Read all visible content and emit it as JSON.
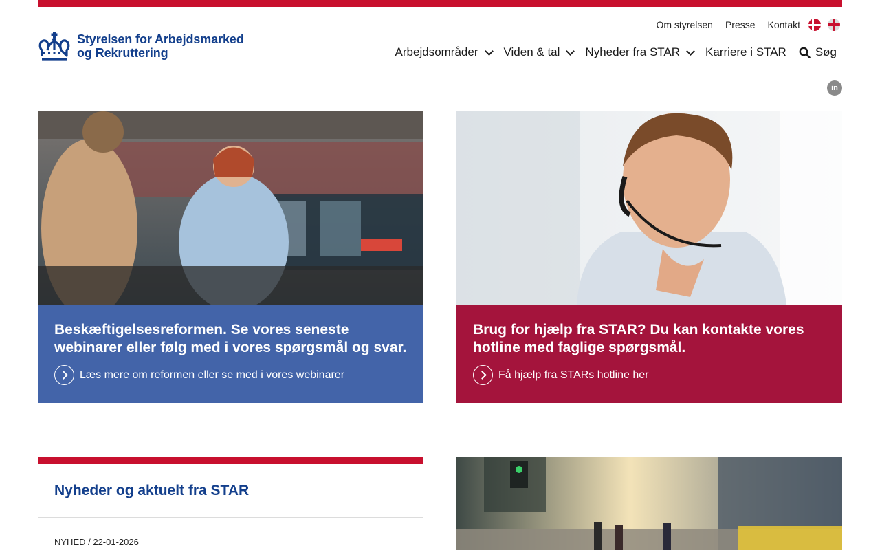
{
  "header": {
    "logo_text_line1": "Styrelsen for Arbejdsmarked",
    "logo_text_line2": "og Rekruttering",
    "utility_links": [
      "Om styrelsen",
      "Presse",
      "Kontakt"
    ],
    "nav": [
      {
        "label": "Arbejdsområder",
        "dropdown": true
      },
      {
        "label": "Viden & tal",
        "dropdown": true
      },
      {
        "label": "Nyheder fra STAR",
        "dropdown": true
      },
      {
        "label": "Karriere i STAR",
        "dropdown": false
      }
    ],
    "search_label": "Søg",
    "linkedin_label": "in"
  },
  "colors": {
    "brand_red": "#c8102e",
    "brand_blue": "#133f8c",
    "card_blue": "#4364a9",
    "card_red": "#a4143c"
  },
  "cards": [
    {
      "title": "Beskæftigelsesreformen. Se vores seneste webinarer eller følg med i vores spørgsmål og svar.",
      "link": "Læs mere om reformen eller se med i vores webinarer"
    },
    {
      "title": "Brug for hjælp fra STAR? Du kan kontakte vores hotline med faglige spørgsmål.",
      "link": "Få hjælp fra STARs hotline her"
    }
  ],
  "news": {
    "title": "Nyheder og aktuelt fra STAR",
    "first_item_meta": "NYHED / 22-01-2026"
  }
}
